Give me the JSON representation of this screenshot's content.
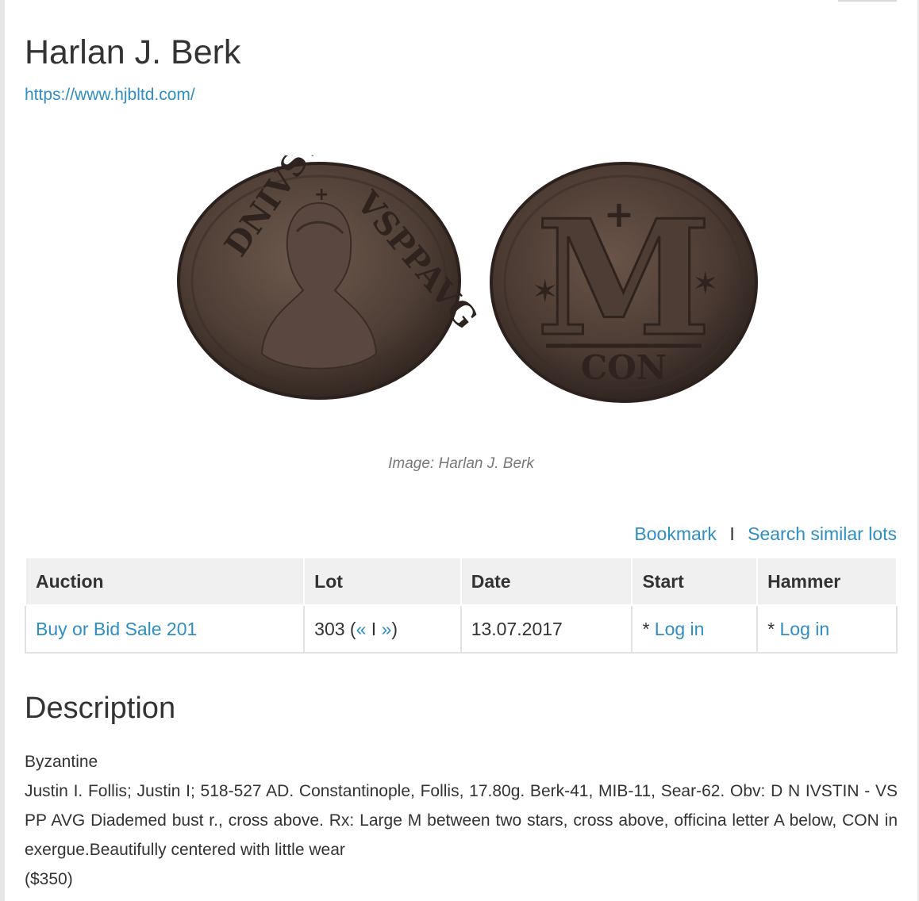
{
  "seller": {
    "name": "Harlan J. Berk",
    "url": "https://www.hjbltd.com/"
  },
  "image": {
    "caption": "Image: Harlan J. Berk",
    "obverse_legend": "DNIVSTIN VSPPAVG",
    "reverse_exergue": "CON",
    "reverse_letter": "M"
  },
  "actions": {
    "bookmark": "Bookmark",
    "separator": "I",
    "search_similar": "Search similar lots"
  },
  "table": {
    "headers": {
      "auction": "Auction",
      "lot": "Lot",
      "date": "Date",
      "start": "Start",
      "hammer": "Hammer"
    },
    "row": {
      "auction": "Buy or Bid Sale 201",
      "lot_number": "303",
      "prev": "«",
      "lot_sep": "I",
      "next": "»",
      "date": "13.07.2017",
      "start_prefix": "*",
      "start_link": "Log in",
      "hammer_prefix": "*",
      "hammer_link": "Log in"
    }
  },
  "description": {
    "title": "Description",
    "category": "Byzantine",
    "body": "Justin I. Follis; Justin I; 518-527 AD. Constantinople, Follis, 17.80g. Berk-41, MIB-11, Sear-62. Obv: D N IVSTIN - VS PP AVG Diademed bust r., cross above. Rx: Large M between two stars, cross above, officina letter A below, CON in exergue.Beautifully centered with little wear",
    "price": "($350)"
  }
}
